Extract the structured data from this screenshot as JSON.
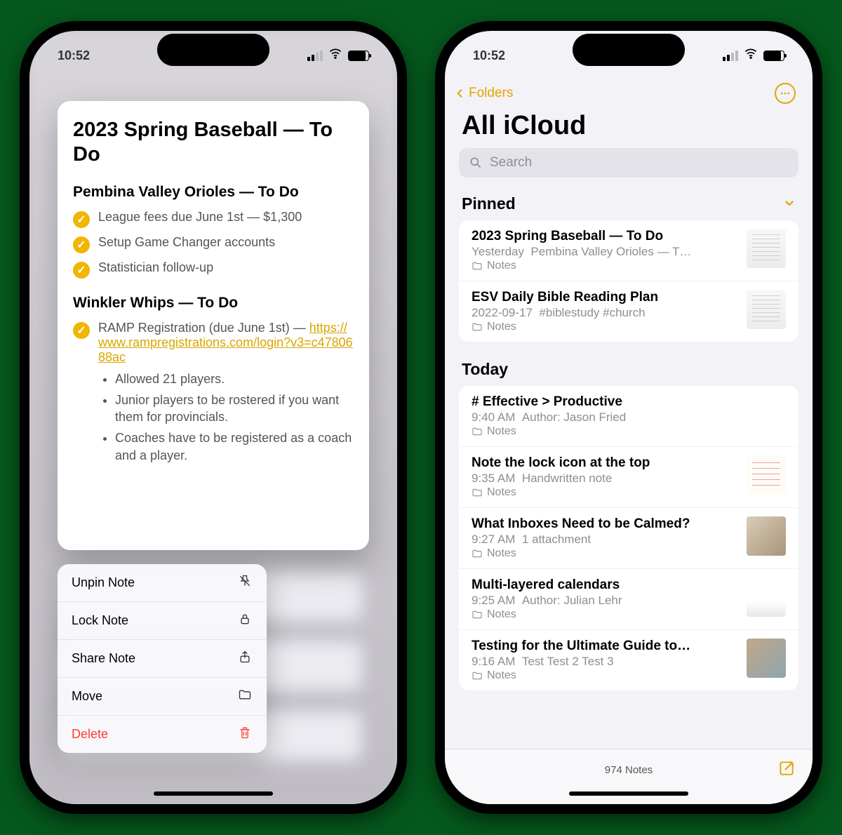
{
  "status": {
    "time": "10:52"
  },
  "left": {
    "preview": {
      "title": "2023 Spring Baseball — To Do",
      "section1": {
        "heading": "Pembina Valley Orioles — To Do",
        "items": [
          "League fees due June 1st — $1,300",
          "Setup Game Changer accounts",
          "Statistician follow-up"
        ]
      },
      "section2": {
        "heading": "Winkler Whips — To Do",
        "item1_pre": "RAMP Registration (due June 1st) — ",
        "item1_link": "https://www.rampregistrations.com/login?v3=c4780688ac",
        "bullets": [
          "Allowed 21 players.",
          "Junior players to be rostered if you want them for provincials.",
          "Coaches have to be registered as a coach and a player."
        ]
      }
    },
    "menu": {
      "unpin": "Unpin Note",
      "lock": "Lock Note",
      "share": "Share Note",
      "move": "Move",
      "delete": "Delete"
    }
  },
  "right": {
    "back_label": "Folders",
    "title": "All iCloud",
    "search_placeholder": "Search",
    "pinned_header": "Pinned",
    "today_header": "Today",
    "folder_label": "Notes",
    "pinned": [
      {
        "title": "2023 Spring Baseball — To Do",
        "time": "Yesterday",
        "snippet": "Pembina Valley Orioles — T…",
        "thumb": "doc"
      },
      {
        "title": "ESV Daily Bible Reading Plan",
        "time": "2022-09-17",
        "snippet": "#biblestudy #church",
        "thumb": "doc"
      }
    ],
    "today": [
      {
        "title": "# Effective > Productive",
        "time": "9:40 AM",
        "snippet": "Author: Jason Fried",
        "thumb": ""
      },
      {
        "title": "Note the lock icon at the top",
        "time": "9:35 AM",
        "snippet": "Handwritten note",
        "thumb": "hand"
      },
      {
        "title": "What Inboxes Need to be Calmed?",
        "time": "9:27 AM",
        "snippet": "1 attachment",
        "thumb": "photo1"
      },
      {
        "title": "Multi-layered calendars",
        "time": "9:25 AM",
        "snippet": "Author: Julian Lehr",
        "thumb": "photo2"
      },
      {
        "title": "Testing for the Ultimate Guide to…",
        "time": "9:16 AM",
        "snippet": "Test Test 2 Test 3",
        "thumb": "photo3"
      }
    ],
    "footer_count": "974 Notes"
  }
}
